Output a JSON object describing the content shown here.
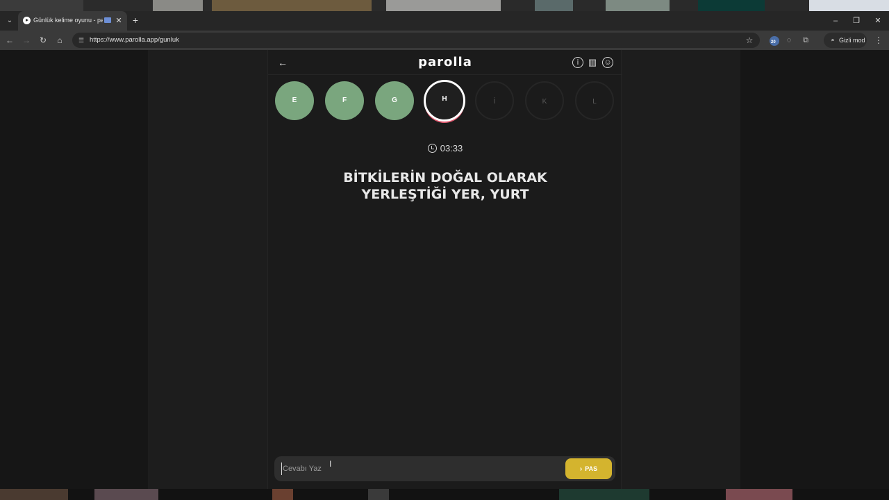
{
  "browser": {
    "tab": {
      "title": "Günlük kelime oyunu - par",
      "favicon": "play-icon"
    },
    "address": {
      "url": "https://www.parolla.app/gunluk"
    },
    "extension_badge": "20",
    "incognito_label": "Gizli mod"
  },
  "app": {
    "logo": "parolla",
    "header_icons": [
      "info-icon",
      "stats-icon",
      "user-icon"
    ],
    "letters": [
      {
        "letter": "E",
        "state": "done"
      },
      {
        "letter": "F",
        "state": "done"
      },
      {
        "letter": "G",
        "state": "done"
      },
      {
        "letter": "H",
        "state": "current"
      },
      {
        "letter": "İ",
        "state": "pending"
      },
      {
        "letter": "K",
        "state": "pending"
      },
      {
        "letter": "L",
        "state": "pending"
      }
    ],
    "timer": "03:33",
    "question_line1": "BİTKİLERİN DOĞAL OLARAK",
    "question_line2": "YERLEŞTİĞİ YER, YURT",
    "answer": {
      "placeholder": "Cevabı Yaz",
      "value": ""
    },
    "pass_button": "PAS"
  },
  "colors": {
    "done": "#7aa67e",
    "current_ring": "#ffffff",
    "current_accent": "#e05a70",
    "pass_button": "#d4b42e"
  }
}
